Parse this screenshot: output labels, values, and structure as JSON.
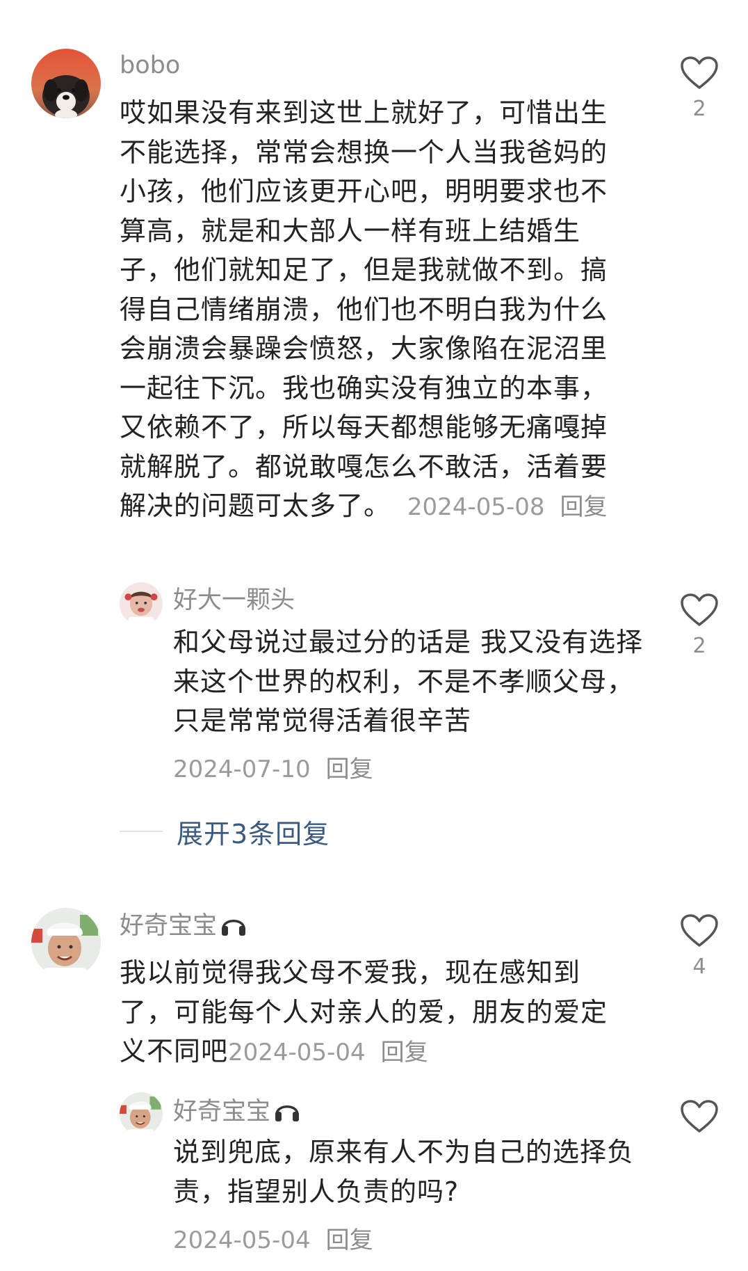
{
  "comments": [
    {
      "username": "bobo",
      "text": "哎如果没有来到这世上就好了，可惜出生不能选择，常常会想换一个人当我爸妈的小孩，他们应该更开心吧，明明要求也不算高，就是和大部人一样有班上结婚生子，他们就知足了，但是我就做不到。搞得自己情绪崩溃，他们也不明白我为什么会崩溃会暴躁会愤怒，大家像陷在泥沼里一起往下沉。我也确实没有独立的本事，又依赖不了，所以每天都想能够无痛嘎掉就解脱了。都说敢嘎怎么不敢活，活着要解决的问题可太多了。",
      "date": "2024-05-08",
      "reply_label": "回复",
      "likes": "2",
      "avatar_icon": "dog-avatar-icon",
      "reply": {
        "username": "好大一颗头",
        "text": "和父母说过最过分的话是 我又没有选择来这个世界的权利，不是不孝顺父母，只是常常觉得活着很辛苦",
        "date": "2024-07-10",
        "reply_label": "回复",
        "likes": "2"
      },
      "expand_label": "展开3条回复"
    },
    {
      "username": "好奇宝宝",
      "text": "我以前觉得我父母不爱我，现在感知到了，可能每个人对亲人的爱，朋友的爱定义不同吧",
      "date": "2024-05-04",
      "reply_label": "回复",
      "likes": "4",
      "username_icon": "headphones-icon",
      "reply": {
        "username": "好奇宝宝",
        "text": "说到兜底，原来有人不为自己的选择负责，指望别人负责的吗?",
        "date": "2024-05-04",
        "reply_label": "回复",
        "likes": ""
      }
    }
  ],
  "colors": {
    "text": "#222222",
    "meta": "#9b9b9b",
    "link": "#3a5a80",
    "heart_outline": "#555555"
  }
}
